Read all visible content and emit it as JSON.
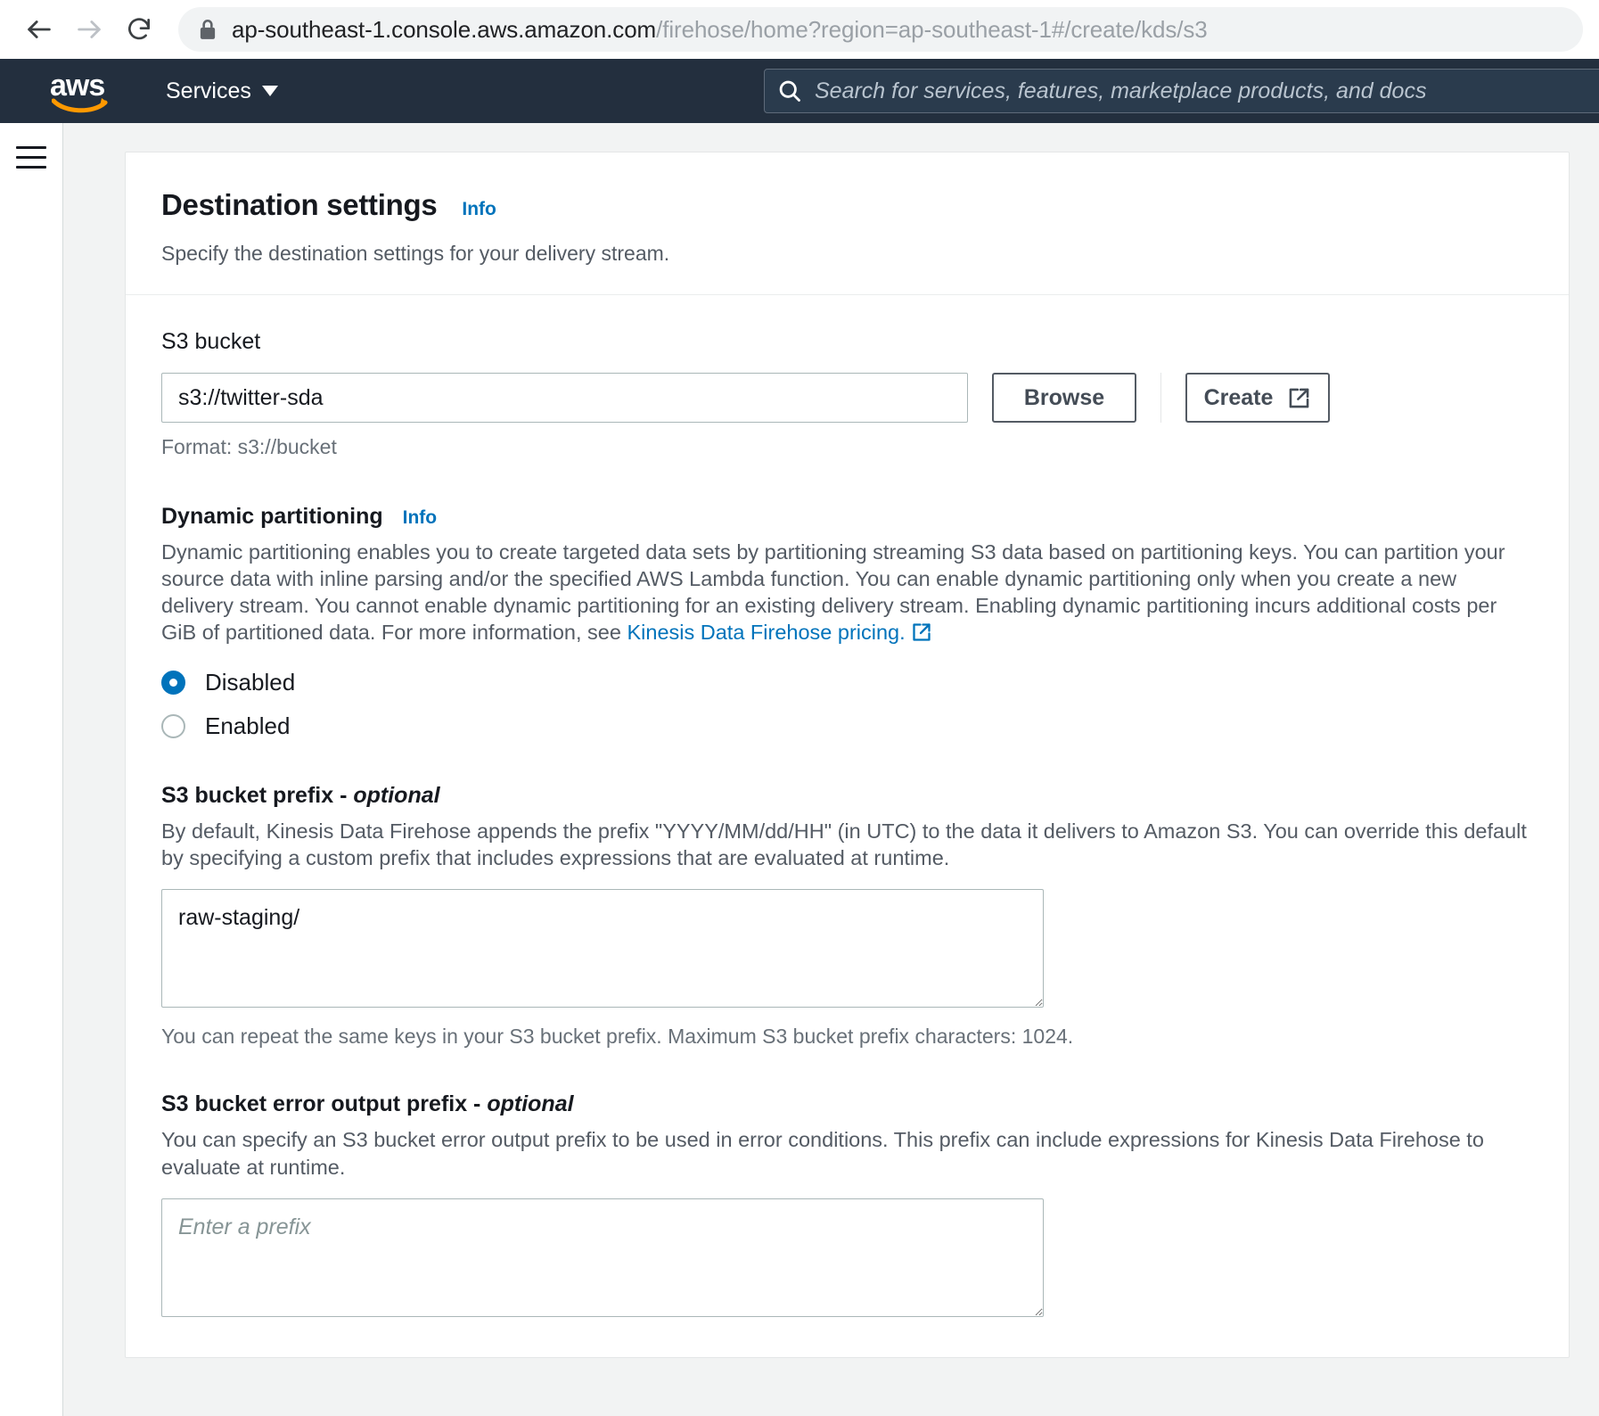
{
  "browser": {
    "back_icon": "back-arrow-icon",
    "forward_icon": "forward-arrow-icon",
    "reload_icon": "reload-icon",
    "lock_icon": "lock-icon",
    "url_host": "ap-southeast-1.console.aws.amazon.com",
    "url_path": "/firehose/home?region=ap-southeast-1#/create/kds/s3"
  },
  "aws_nav": {
    "logo_text": "aws",
    "services_label": "Services",
    "search_placeholder": "Search for services, features, marketplace products, and docs",
    "search_icon": "search-icon"
  },
  "sidebar": {
    "menu_icon": "hamburger-menu-icon"
  },
  "panel": {
    "title": "Destination settings",
    "info_label": "Info",
    "subtitle": "Specify the destination settings for your delivery stream."
  },
  "s3_bucket": {
    "label": "S3 bucket",
    "value": "s3://twitter-sda",
    "placeholder": "s3://bucket",
    "browse_label": "Browse",
    "create_label": "Create",
    "create_external_icon": "external-link-icon",
    "format_hint": "Format: s3://bucket"
  },
  "dynamic_partitioning": {
    "label": "Dynamic partitioning",
    "info_label": "Info",
    "description_before_link": "Dynamic partitioning enables you to create targeted data sets by partitioning streaming S3 data based on partitioning keys. You can partition your source data with inline parsing and/or the specified AWS Lambda function. You can enable dynamic partitioning only when you create a new delivery stream. You cannot enable dynamic partitioning for an existing delivery stream. Enabling dynamic partitioning incurs additional costs per GiB of partitioned data. For more information, see ",
    "link_text": "Kinesis Data Firehose pricing.",
    "link_external_icon": "external-link-icon",
    "options": [
      {
        "label": "Disabled",
        "selected": true
      },
      {
        "label": "Enabled",
        "selected": false
      }
    ]
  },
  "bucket_prefix": {
    "label": "S3 bucket prefix - ",
    "label_optional": "optional",
    "description": "By default, Kinesis Data Firehose appends the prefix \"YYYY/MM/dd/HH\" (in UTC) to the data it delivers to Amazon S3. You can override this default by specifying a custom prefix that includes expressions that are evaluated at runtime.",
    "value": "raw-staging/",
    "hint": "You can repeat the same keys in your S3 bucket prefix. Maximum S3 bucket prefix characters: 1024."
  },
  "error_output_prefix": {
    "label": "S3 bucket error output prefix - ",
    "label_optional": "optional",
    "description": "You can specify an S3 bucket error output prefix to be used in error conditions. This prefix can include expressions for Kinesis Data Firehose to evaluate at runtime.",
    "value": "",
    "placeholder": "Enter a prefix"
  },
  "colors": {
    "aws_nav_bg": "#232f3e",
    "aws_orange": "#ff9900",
    "link_blue": "#0073bb",
    "page_bg": "#f2f3f3"
  }
}
